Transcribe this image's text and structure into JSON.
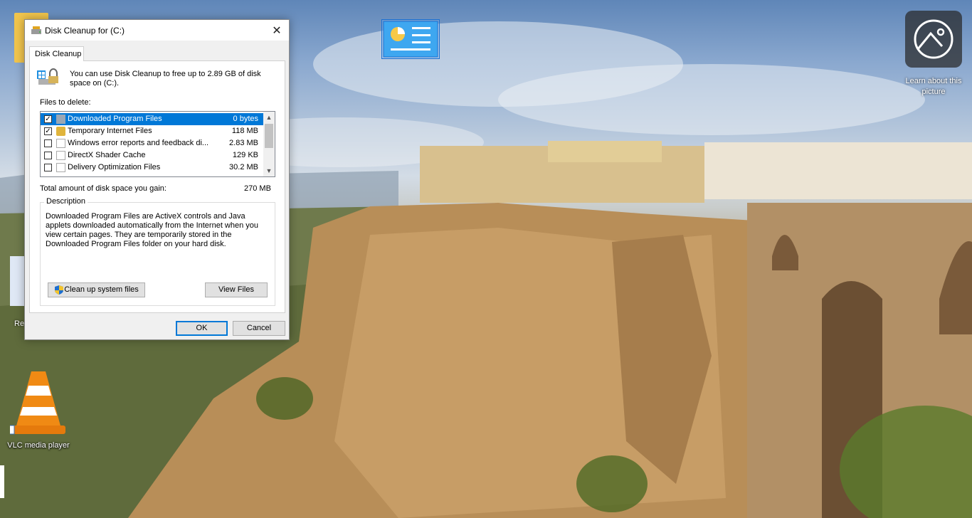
{
  "dialog": {
    "title": "Disk Cleanup for  (C:)",
    "tab": "Disk Cleanup",
    "intro": "You can use Disk Cleanup to free up to 2.89 GB of disk space on  (C:).",
    "files_label": "Files to delete:",
    "files": [
      {
        "name": "Downloaded Program Files",
        "size": "0 bytes",
        "checked": true,
        "selected": true
      },
      {
        "name": "Temporary Internet Files",
        "size": "118 MB",
        "checked": true,
        "selected": false
      },
      {
        "name": "Windows error reports and feedback di...",
        "size": "2.83 MB",
        "checked": false,
        "selected": false
      },
      {
        "name": "DirectX Shader Cache",
        "size": "129 KB",
        "checked": false,
        "selected": false
      },
      {
        "name": "Delivery Optimization Files",
        "size": "30.2 MB",
        "checked": false,
        "selected": false
      }
    ],
    "total_label": "Total amount of disk space you gain:",
    "total_value": "270 MB",
    "description_title": "Description",
    "description": "Downloaded Program Files are ActiveX controls and Java applets downloaded automatically from the Internet when you view certain pages. They are temporarily stored in the Downloaded Program Files folder on your hard disk.",
    "cleanup_button": "Clean up system files",
    "view_button": "View Files",
    "ok_button": "OK",
    "cancel_button": "Cancel"
  },
  "desktop": {
    "learn_label": "Learn about this picture",
    "vlc_label": "VLC media player",
    "recycle_partial": "Re"
  },
  "colors": {
    "selection": "#0078d7",
    "dialog_bg": "#f0f0f0"
  }
}
